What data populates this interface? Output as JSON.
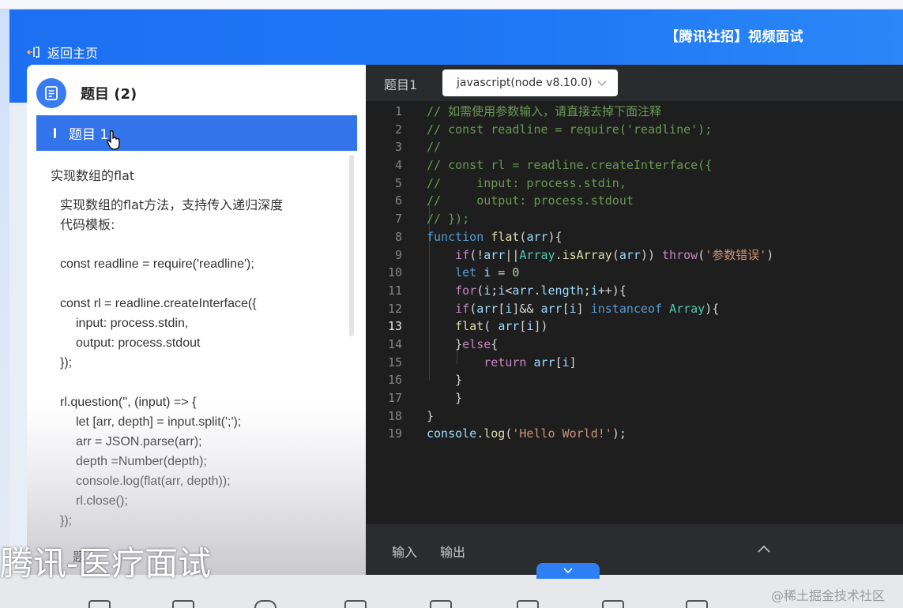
{
  "header": {
    "back_label": "返回主页",
    "interview_title": "【腾讯社招】视频面试"
  },
  "sidebar": {
    "title": "题目 (2)",
    "active_tab": "题目 1",
    "problem_name": "实现数组的flat",
    "description": [
      "实现数组的flat方法，支持传入递归深度",
      "代码模板:"
    ],
    "template_lines": [
      {
        "text": "const readline = require('readline');",
        "indent": 0
      },
      {
        "text": "",
        "indent": 0
      },
      {
        "text": "const rl = readline.createInterface({",
        "indent": 0
      },
      {
        "text": "input: process.stdin,",
        "indent": 1
      },
      {
        "text": "output: process.stdout",
        "indent": 1
      },
      {
        "text": "});",
        "indent": 0
      },
      {
        "text": "",
        "indent": 0
      },
      {
        "text": "rl.question('', (input) => {",
        "indent": 0
      },
      {
        "text": "let [arr, depth] = input.split(';');",
        "indent": 1
      },
      {
        "text": "arr = JSON.parse(arr);",
        "indent": 1
      },
      {
        "text": "depth =Number(depth);",
        "indent": 1
      },
      {
        "text": "console.log(flat(arr, depth));",
        "indent": 1
      },
      {
        "text": "rl.close();",
        "indent": 1
      },
      {
        "text": "});",
        "indent": 0
      }
    ],
    "cut_text": "题"
  },
  "editor": {
    "tab_label": "题目1",
    "language": "javascript(node v8.10.0)",
    "current_line": 13,
    "lines": [
      [
        [
          "c-com",
          "// 如需使用参数输入，请直接去掉下面注释"
        ]
      ],
      [
        [
          "c-com",
          "// const readline = require('readline');"
        ]
      ],
      [
        [
          "c-com",
          "//"
        ]
      ],
      [
        [
          "c-com",
          "// const rl = readline.createInterface({"
        ]
      ],
      [
        [
          "c-com",
          "//     input: process.stdin,"
        ]
      ],
      [
        [
          "c-com",
          "//     output: process.stdout"
        ]
      ],
      [
        [
          "c-com",
          "// });"
        ]
      ],
      [
        [
          "c-kw",
          "function"
        ],
        [
          "",
          " "
        ],
        [
          "c-fn",
          "flat"
        ],
        [
          "",
          "("
        ],
        [
          "c-var",
          "arr"
        ],
        [
          "",
          "){"
        ]
      ],
      [
        [
          "",
          "    "
        ],
        [
          "c-ctl",
          "if"
        ],
        [
          "",
          "(!"
        ],
        [
          "c-var",
          "arr"
        ],
        [
          "",
          "||"
        ],
        [
          "c-type",
          "Array"
        ],
        [
          "",
          "."
        ],
        [
          "c-fn",
          "isArray"
        ],
        [
          "",
          "("
        ],
        [
          "c-var",
          "arr"
        ],
        [
          "",
          ")) "
        ],
        [
          "c-ctl",
          "throw"
        ],
        [
          "",
          "("
        ],
        [
          "c-str",
          "'参数错误'"
        ],
        [
          "",
          ")"
        ]
      ],
      [
        [
          "",
          "    "
        ],
        [
          "c-kw",
          "let"
        ],
        [
          "",
          " "
        ],
        [
          "c-var",
          "i"
        ],
        [
          "",
          " = "
        ],
        [
          "c-num",
          "0"
        ]
      ],
      [
        [
          "",
          "    "
        ],
        [
          "c-ctl",
          "for"
        ],
        [
          "",
          "("
        ],
        [
          "c-var",
          "i"
        ],
        [
          "",
          ";"
        ],
        [
          "c-var",
          "i"
        ],
        [
          "",
          "<"
        ],
        [
          "c-var",
          "arr"
        ],
        [
          "",
          "."
        ],
        [
          "c-var",
          "length"
        ],
        [
          "",
          ";"
        ],
        [
          "c-var",
          "i"
        ],
        [
          "",
          "++){"
        ]
      ],
      [
        [
          "",
          "    "
        ],
        [
          "c-ctl",
          "if"
        ],
        [
          "",
          "("
        ],
        [
          "c-var",
          "arr"
        ],
        [
          "",
          "["
        ],
        [
          "c-var",
          "i"
        ],
        [
          "",
          "]&& "
        ],
        [
          "c-var",
          "arr"
        ],
        [
          "",
          "["
        ],
        [
          "c-var",
          "i"
        ],
        [
          "",
          "] "
        ],
        [
          "c-kw",
          "instanceof"
        ],
        [
          "",
          " "
        ],
        [
          "c-type",
          "Array"
        ],
        [
          "",
          "){"
        ]
      ],
      [
        [
          "",
          "    "
        ],
        [
          "c-fn",
          "flat"
        ],
        [
          "",
          "( "
        ],
        [
          "c-var",
          "arr"
        ],
        [
          "",
          "["
        ],
        [
          "c-var",
          "i"
        ],
        [
          "",
          "])"
        ]
      ],
      [
        [
          "",
          "    }"
        ],
        [
          "c-ctl",
          "else"
        ],
        [
          "",
          "{"
        ]
      ],
      [
        [
          "",
          "        "
        ],
        [
          "c-ctl",
          "return"
        ],
        [
          "",
          " "
        ],
        [
          "c-var",
          "arr"
        ],
        [
          "",
          "["
        ],
        [
          "c-var",
          "i"
        ],
        [
          "",
          "]"
        ]
      ],
      [
        [
          "",
          "    }"
        ]
      ],
      [
        [
          "",
          "    }"
        ]
      ],
      [
        [
          "",
          "}"
        ]
      ],
      [
        [
          "c-var",
          "console"
        ],
        [
          "",
          "."
        ],
        [
          "c-fn",
          "log"
        ],
        [
          "",
          "("
        ],
        [
          "c-str",
          "'Hello World!'"
        ],
        [
          "",
          ");"
        ]
      ]
    ],
    "footer": {
      "input_tab": "输入",
      "output_tab": "输出"
    }
  },
  "overlay": {
    "subtitle": "腾讯-医疗面试",
    "watermark": "@稀土掘金技术社区"
  },
  "colors": {
    "accent": "#3474ea",
    "editor_bg": "#1e1e1e"
  }
}
